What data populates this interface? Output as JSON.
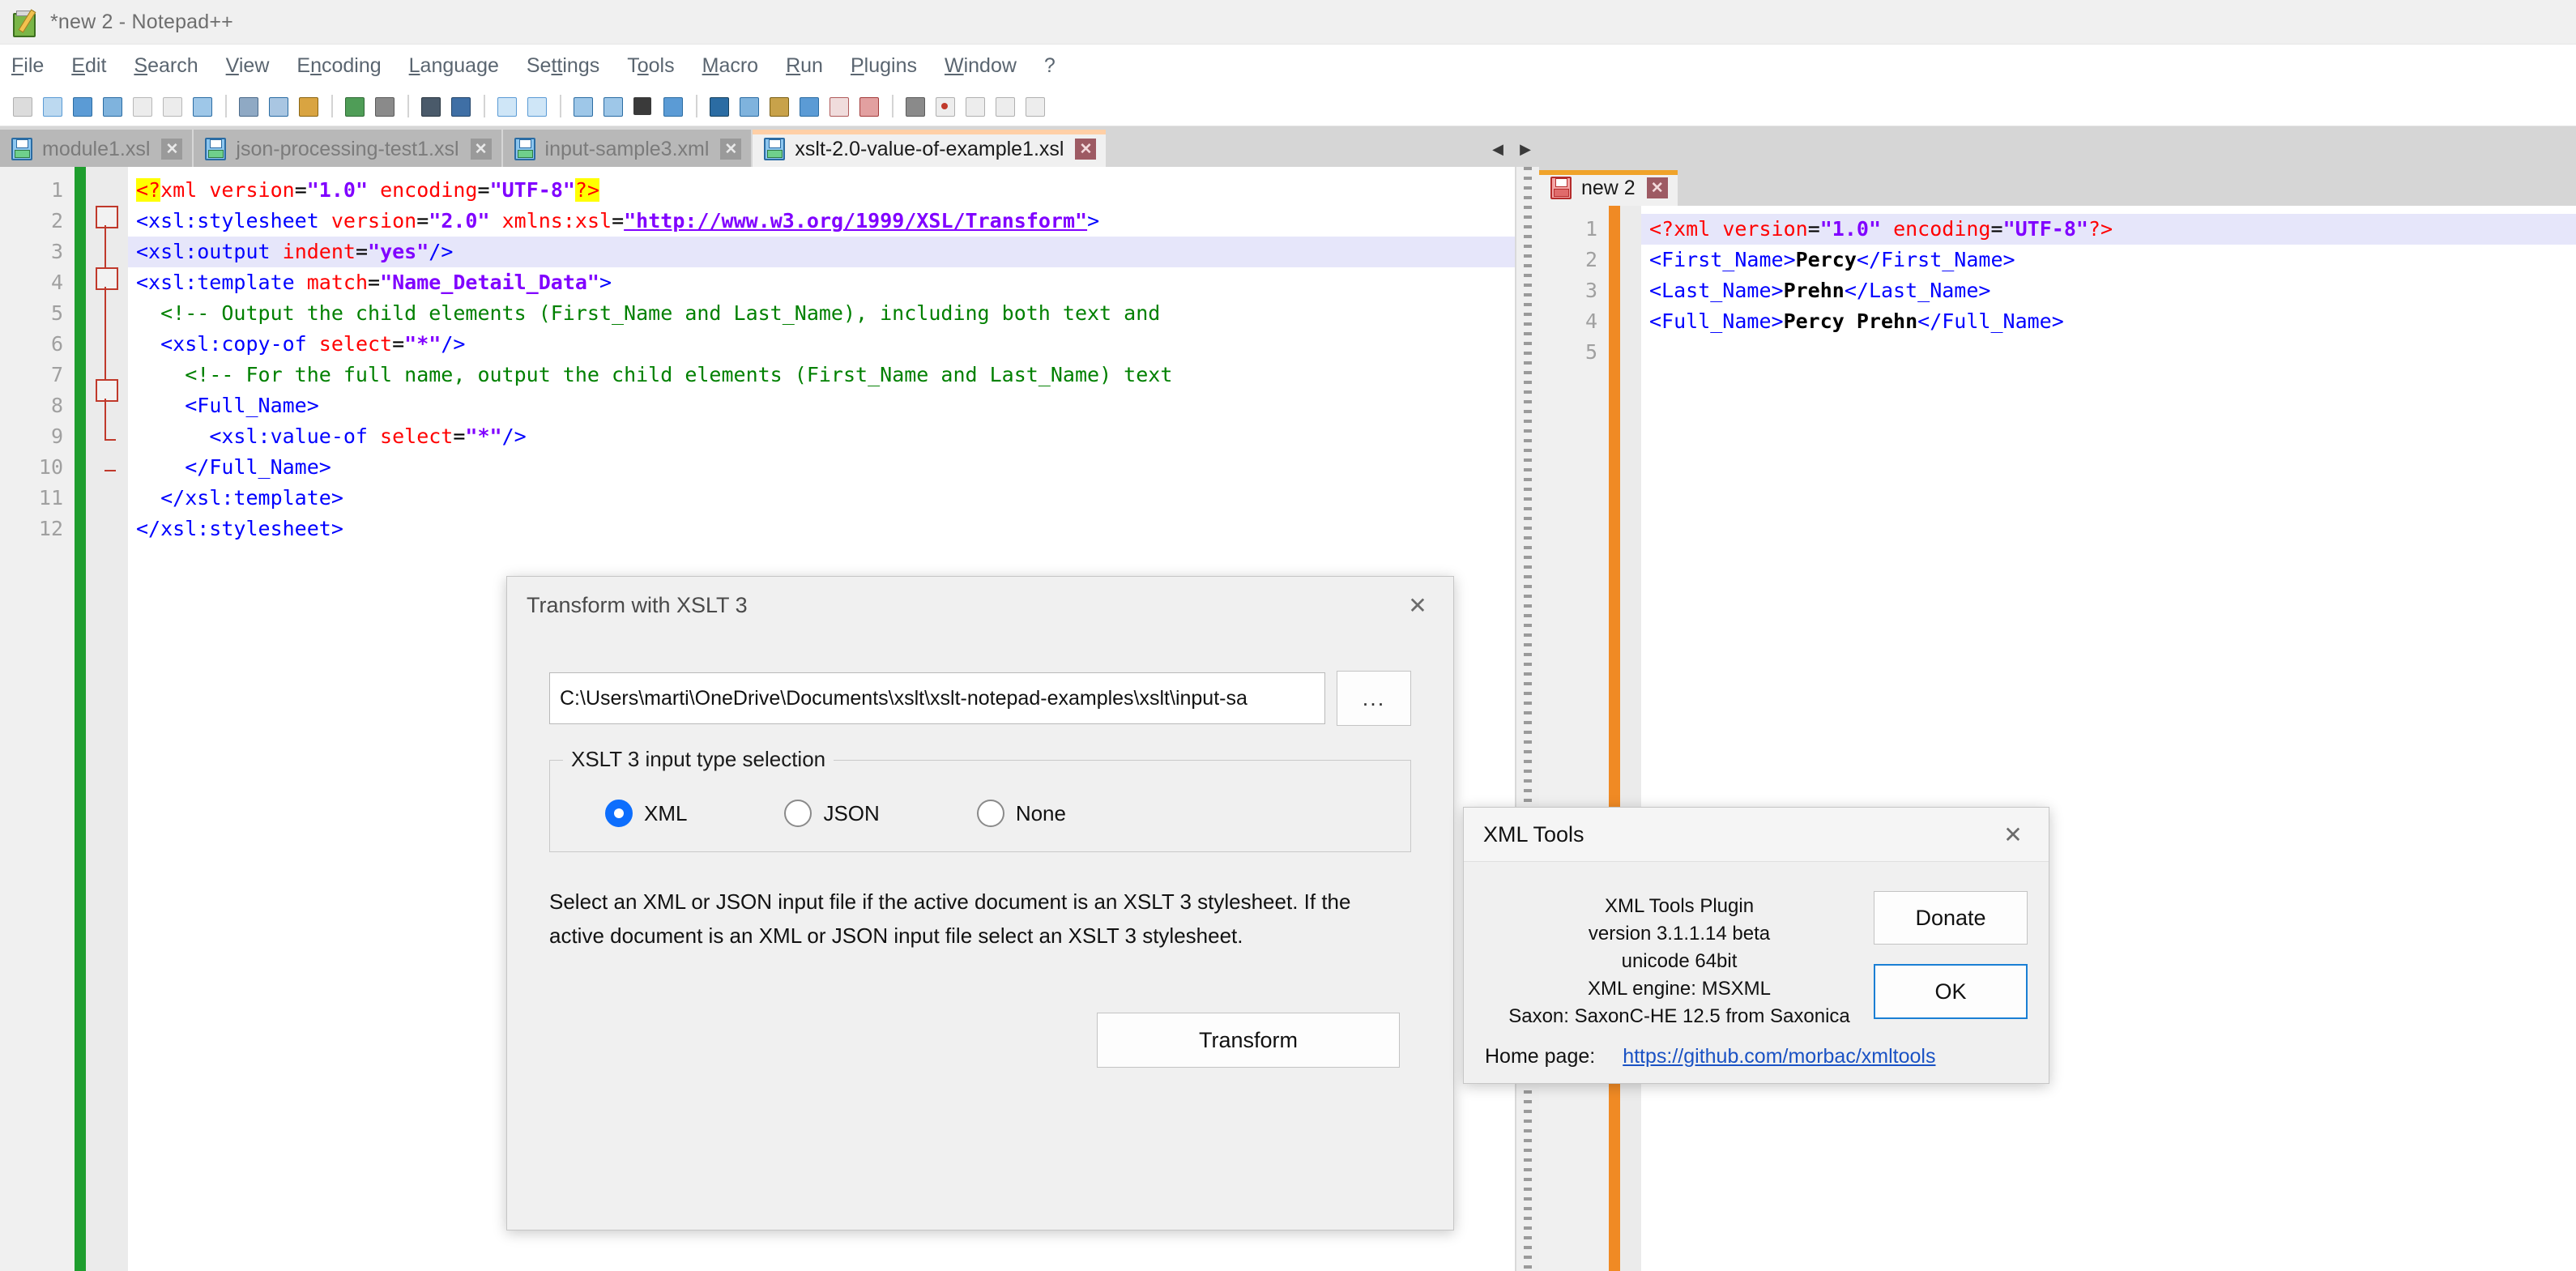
{
  "window": {
    "title": "*new 2 - Notepad++",
    "app_icon": "notepad-plus-plus-icon"
  },
  "menu": {
    "items": [
      {
        "label": "File"
      },
      {
        "label": "Edit"
      },
      {
        "label": "Search"
      },
      {
        "label": "View"
      },
      {
        "label": "Encoding"
      },
      {
        "label": "Language"
      },
      {
        "label": "Settings"
      },
      {
        "label": "Tools"
      },
      {
        "label": "Macro"
      },
      {
        "label": "Run"
      },
      {
        "label": "Plugins"
      },
      {
        "label": "Window"
      },
      {
        "label": "?"
      }
    ]
  },
  "toolbar": {
    "buttons": [
      {
        "name": "new-file-icon",
        "color": "#d9d9d9"
      },
      {
        "name": "open-file-icon",
        "color": "#bcd9f0"
      },
      {
        "name": "save-icon",
        "color": "#5b9bd5"
      },
      {
        "name": "save-all-icon",
        "color": "#7fb3dd"
      },
      {
        "name": "close-icon",
        "color": "#e0e0e0"
      },
      {
        "name": "close-all-icon",
        "color": "#e0e0e0"
      },
      {
        "name": "print-icon",
        "color": "#9ec7e8"
      },
      {
        "name": "cut-icon",
        "color": "#8fa9c4"
      },
      {
        "name": "copy-icon",
        "color": "#a9c6e2"
      },
      {
        "name": "paste-icon",
        "color": "#d9a441"
      },
      {
        "name": "undo-icon",
        "color": "#4f9d57"
      },
      {
        "name": "redo-icon",
        "color": "#8a8a8a"
      },
      {
        "name": "find-icon",
        "color": "#4a5a6a"
      },
      {
        "name": "replace-icon",
        "color": "#3f6fa5"
      },
      {
        "name": "zoom-in-icon",
        "color": "#bcd9f0"
      },
      {
        "name": "zoom-out-icon",
        "color": "#bcd9f0"
      },
      {
        "name": "sync-v-icon",
        "color": "#7fb3dd"
      },
      {
        "name": "sync-h-icon",
        "color": "#7fb3dd"
      },
      {
        "name": "word-wrap-icon",
        "color": "#3a3a3a"
      },
      {
        "name": "all-chars-icon",
        "color": "#5b9bd5"
      },
      {
        "name": "indent-guide-icon",
        "color": "#2b6ca3"
      },
      {
        "name": "user-dlg-icon",
        "color": "#7fb3dd"
      },
      {
        "name": "doc-map-icon",
        "color": "#c8a24a"
      },
      {
        "name": "func-list-icon",
        "color": "#5b9bd5"
      },
      {
        "name": "folder-workspace-icon",
        "color": "#e0b0b0"
      },
      {
        "name": "monitoring-icon",
        "color": "#d88b8b"
      },
      {
        "name": "macro-record-icon",
        "color": "#8a8a8a"
      },
      {
        "name": "macro-stop-icon",
        "color": "#c0392b"
      },
      {
        "name": "macro-play-icon",
        "color": "#9a9a9a"
      },
      {
        "name": "macro-multi-icon",
        "color": "#9a9a9a"
      },
      {
        "name": "macro-save-icon",
        "color": "#9a9a9a"
      }
    ]
  },
  "tabs": {
    "items": [
      {
        "label": "module1.xsl",
        "icon": "floppy-blue-icon",
        "active": false
      },
      {
        "label": "json-processing-test1.xsl",
        "icon": "floppy-blue-icon",
        "active": false
      },
      {
        "label": "input-sample3.xml",
        "icon": "floppy-blue-icon",
        "active": false
      },
      {
        "label": "xslt-2.0-value-of-example1.xsl",
        "icon": "floppy-blue-icon",
        "active": true
      }
    ],
    "scroll_left": "◀",
    "scroll_right": "▶"
  },
  "left_editor": {
    "line_numbers": [
      "1",
      "2",
      "3",
      "4",
      "5",
      "6",
      "7",
      "8",
      "9",
      "10",
      "11",
      "12"
    ],
    "lines": [
      "<?xml version=\"1.0\" encoding=\"UTF-8\"?>",
      "<xsl:stylesheet version=\"2.0\" xmlns:xsl=\"http://www.w3.org/1999/XSL/Transform\">",
      "<xsl:output indent=\"yes\"/>",
      "<xsl:template match=\"Name_Detail_Data\">",
      "   <!-- Output the child elements (First_Name and Last_Name), including both text and",
      "   <xsl:copy-of select=\"*\"/>",
      "     <!-- For the full name, output the child elements (First_Name and Last_Name) text",
      "     <Full_Name>",
      "       <xsl:value-of select=\"*\"/>",
      "     </Full_Name>",
      "   </xsl:template>",
      "</xsl:stylesheet>"
    ]
  },
  "right_pane": {
    "tab": {
      "label": "new 2",
      "icon": "floppy-red-icon"
    },
    "line_numbers": [
      "1",
      "2",
      "3",
      "4",
      "5"
    ],
    "lines": [
      "<?xml version=\"1.0\" encoding=\"UTF-8\"?>",
      "<First_Name>Percy</First_Name>",
      "<Last_Name>Prehn</Last_Name>",
      "<Full_Name>Percy Prehn</Full_Name>",
      ""
    ]
  },
  "xslt_dialog": {
    "title": "Transform with XSLT 3",
    "close_label": "✕",
    "path_value": "C:\\Users\\marti\\OneDrive\\Documents\\xslt\\xslt-notepad-examples\\xslt\\input-sa",
    "browse_label": "...",
    "group_legend": "XSLT 3 input type selection",
    "radios": [
      {
        "label": "XML",
        "selected": true
      },
      {
        "label": "JSON",
        "selected": false
      },
      {
        "label": "None",
        "selected": false
      }
    ],
    "description": "Select an XML or JSON input file if the active document is an XSLT 3 stylesheet. If the active document is an XML or JSON input file select an XSLT 3 stylesheet.",
    "transform_label": "Transform"
  },
  "xmltools_dialog": {
    "title": "XML Tools",
    "close_label": "✕",
    "info_lines": [
      "XML Tools Plugin",
      "version 3.1.1.14 beta",
      "unicode 64bit",
      "XML engine: MSXML",
      "Saxon: SaxonC-HE 12.5 from Saxonica"
    ],
    "donate_label": "Donate",
    "ok_label": "OK",
    "home_label": "Home page:",
    "home_url": "https://github.com/morbac/xmltools"
  },
  "colors": {
    "accent_blue": "#0d6efd",
    "active_tab_top": "#ffcfa6",
    "fold_green": "#1e9e2e",
    "fold_orange": "#f08a24",
    "highlight_yellow": "#ffff00",
    "selection_lavender": "#e6e6fa"
  }
}
